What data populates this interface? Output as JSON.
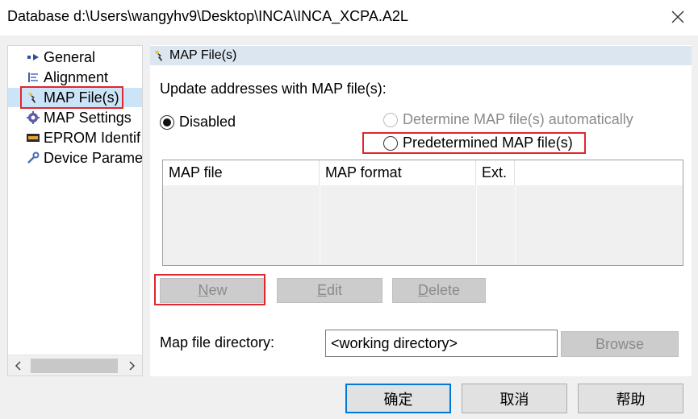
{
  "window": {
    "title": "Database d:\\Users\\wangyhv9\\Desktop\\INCA\\INCA_XCPA.A2L"
  },
  "tree": {
    "items": [
      {
        "label": "General",
        "icon": "general-icon"
      },
      {
        "label": "Alignment",
        "icon": "alignment-icon"
      },
      {
        "label": "MAP File(s)",
        "icon": "map-file-icon",
        "selected": true
      },
      {
        "label": "MAP Settings",
        "icon": "gear-icon"
      },
      {
        "label": "EPROM Identif",
        "icon": "eprom-icon"
      },
      {
        "label": "Device Parame",
        "icon": "wrench-icon"
      }
    ]
  },
  "panel": {
    "header": "MAP File(s)",
    "update_label": "Update addresses with MAP file(s):",
    "options": {
      "disabled": "Disabled",
      "auto": "Determine MAP file(s) automatically",
      "predetermined": "Predetermined MAP file(s)",
      "selected": "disabled"
    },
    "table": {
      "columns": [
        "MAP file",
        "MAP format",
        "Ext.",
        ""
      ],
      "rows": []
    },
    "buttons": {
      "new": {
        "underlined": "N",
        "rest": "ew"
      },
      "edit": {
        "underlined": "E",
        "rest": "dit"
      },
      "delete": {
        "underlined": "D",
        "rest": "elete"
      },
      "browse": "Browse"
    },
    "directory": {
      "label": "Map file directory:",
      "value": "<working directory>"
    }
  },
  "footer": {
    "ok": "确定",
    "cancel": "取消",
    "help": "帮助"
  },
  "colors": {
    "highlight_red": "#e0262e",
    "selection_blue": "#cce4f7",
    "header_blue": "#dbe6f1",
    "focus_blue": "#0078d7"
  }
}
